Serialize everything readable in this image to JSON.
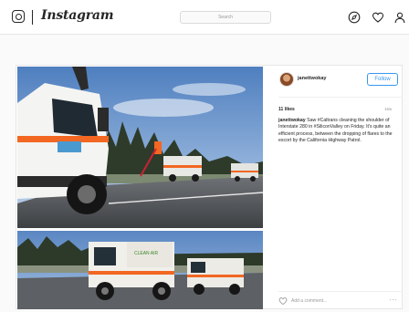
{
  "app": {
    "name": "Instagram",
    "search_placeholder": "Search"
  },
  "nav": {
    "icons": [
      "compass-icon",
      "heart-icon",
      "profile-icon"
    ]
  },
  "post": {
    "username": "janettwokay",
    "follow_label": "Follow",
    "likes": "11 likes",
    "time": "16w",
    "caption_user": "janettwokay",
    "caption_text": "Saw #Caltrans cleaning the shoulder of Interstate 280 in #SiliconValley on Friday. It's quite an efficient process, between the dropping of flares to the escort by the California Highway Patrol.",
    "add_comment_placeholder": "Add a comment...",
    "more_label": "···",
    "truck_text": "CLEAN AIR"
  },
  "colors": {
    "accent": "#3897f0",
    "caltrans_orange": "#f26722"
  }
}
